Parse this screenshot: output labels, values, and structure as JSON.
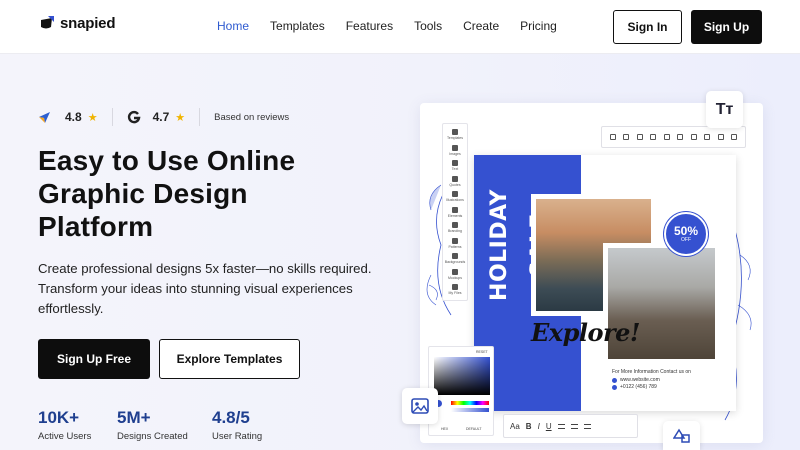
{
  "brand": {
    "name": "snapied"
  },
  "nav": {
    "items": [
      {
        "label": "Home",
        "active": true
      },
      {
        "label": "Templates",
        "active": false
      },
      {
        "label": "Features",
        "active": false
      },
      {
        "label": "Tools",
        "active": false
      },
      {
        "label": "Create",
        "active": false
      },
      {
        "label": "Pricing",
        "active": false
      }
    ],
    "signin_label": "Sign In",
    "signup_label": "Sign Up"
  },
  "ratings": {
    "first_value": "4.8",
    "second_value": "4.7",
    "star": "★",
    "based_text": "Based on reviews"
  },
  "hero": {
    "title_line1": "Easy to Use Online",
    "title_line2": "Graphic Design",
    "title_line3": "Platform",
    "desc_line1": "Create professional designs 5x faster—no skills required.",
    "desc_line2": "Transform your ideas into stunning visual experiences",
    "desc_line3": "effortlessly.",
    "cta_primary": "Sign Up Free",
    "cta_secondary": "Explore Templates"
  },
  "stats": [
    {
      "value": "10K+",
      "label": "Active Users"
    },
    {
      "value": "5M+",
      "label": "Designs Created"
    },
    {
      "value": "4.8/5",
      "label": "User Rating"
    }
  ],
  "mockup": {
    "text_tool_glyph": "Tт",
    "side_panel": [
      "Templates",
      "Images",
      "Text",
      "Quotes",
      "Illustrations",
      "Elements",
      "Branding",
      "Patterns",
      "Backgrounds",
      "Mockups",
      "My Files"
    ],
    "holiday_text": "HOLIDAY SALE",
    "explore_text": "Explore!",
    "pct_value": "50%",
    "pct_off": "OFF",
    "contact_line": "For More Information Contact us on",
    "website": "www.website.com",
    "phone": "+0122 (456) 789",
    "picker_header": "RESET",
    "picker_footer": "HEX",
    "picker_reset": "DEFAULT",
    "bottom_toolbar_text": "Aa",
    "accent_color": "#3551d0"
  }
}
